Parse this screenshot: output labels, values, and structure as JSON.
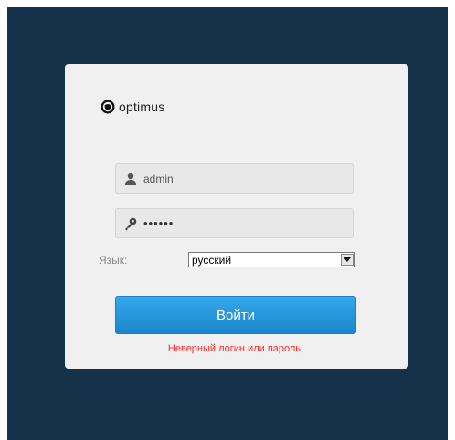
{
  "brand": {
    "name": "optimus",
    "icon": "optimus-logo-icon"
  },
  "login_form": {
    "username": {
      "value": "admin",
      "icon": "user-icon"
    },
    "password": {
      "value": "••••••",
      "icon": "key-icon"
    },
    "language": {
      "label": "Язык:",
      "selected": "русский",
      "icon": "dropdown-arrow-icon"
    },
    "submit_label": "Войти",
    "error_message": "Неверный логин или пароль!"
  },
  "colors": {
    "background": "#15324a",
    "card": "#f0f0f0",
    "button": "#1b8fd6",
    "error": "#ff2a2a"
  }
}
